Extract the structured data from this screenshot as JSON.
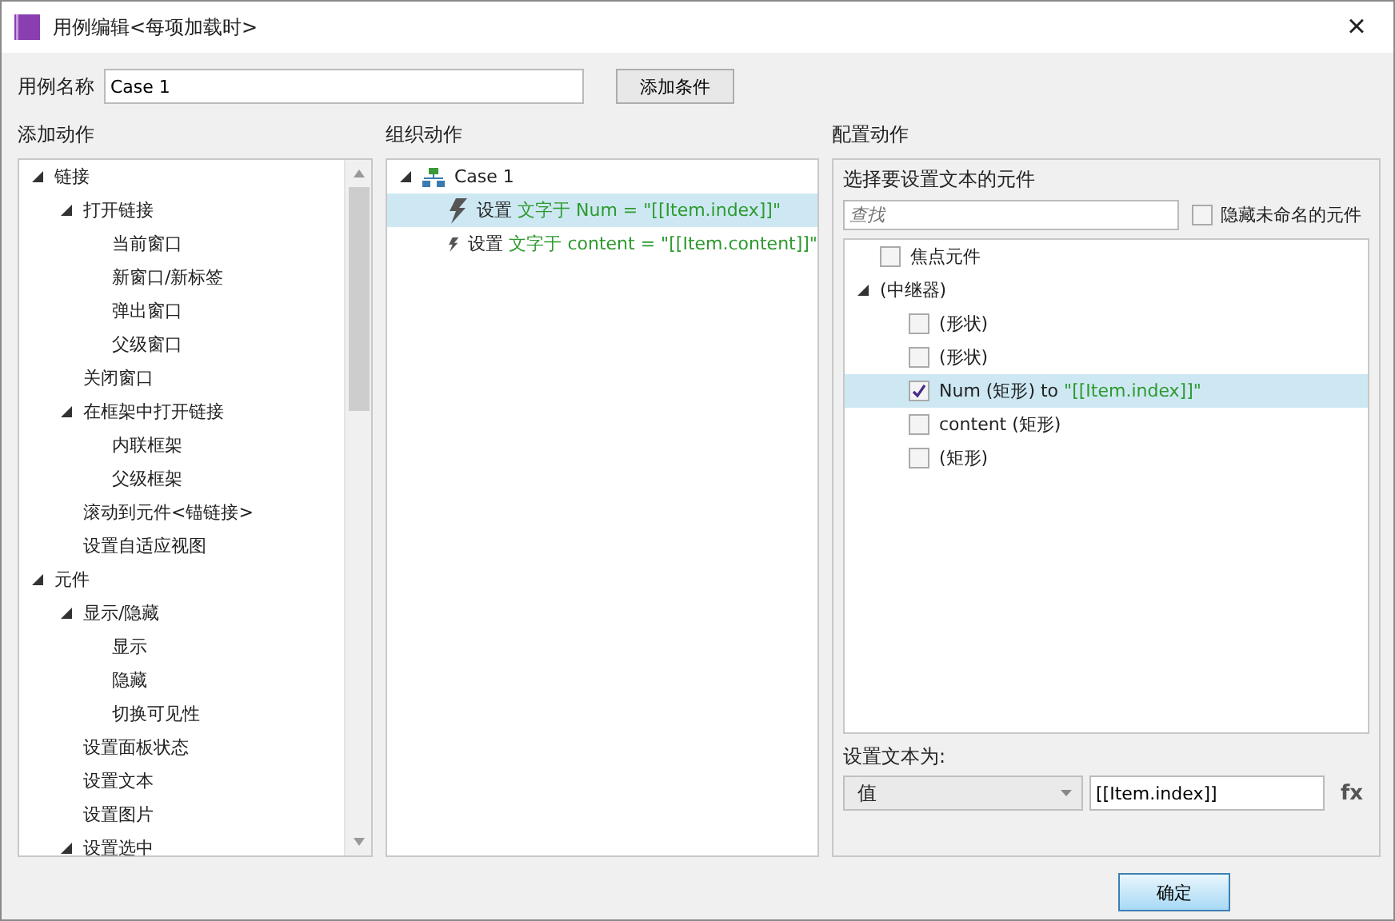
{
  "window": {
    "title": "用例编辑<每项加载时>",
    "close": "×"
  },
  "case_name": {
    "label": "用例名称",
    "value": "Case 1"
  },
  "add_condition_button": "添加条件",
  "add_actions": {
    "heading": "添加动作",
    "tree": [
      {
        "label": "链接",
        "expanded": true,
        "children": [
          {
            "label": "打开链接",
            "expanded": true,
            "children": [
              {
                "label": "当前窗口"
              },
              {
                "label": "新窗口/新标签"
              },
              {
                "label": "弹出窗口"
              },
              {
                "label": "父级窗口"
              }
            ]
          },
          {
            "label": "关闭窗口"
          },
          {
            "label": "在框架中打开链接",
            "expanded": true,
            "children": [
              {
                "label": "内联框架"
              },
              {
                "label": "父级框架"
              }
            ]
          },
          {
            "label": "滚动到元件<锚链接>"
          },
          {
            "label": "设置自适应视图"
          }
        ]
      },
      {
        "label": "元件",
        "expanded": true,
        "children": [
          {
            "label": "显示/隐藏",
            "expanded": true,
            "children": [
              {
                "label": "显示"
              },
              {
                "label": "隐藏"
              },
              {
                "label": "切换可见性"
              }
            ]
          },
          {
            "label": "设置面板状态"
          },
          {
            "label": "设置文本"
          },
          {
            "label": "设置图片"
          },
          {
            "label": "设置选中",
            "expanded": true
          }
        ]
      }
    ]
  },
  "organize_actions": {
    "heading": "组织动作",
    "case": {
      "label": "Case 1",
      "expanded": true
    },
    "actions": [
      {
        "verb": "设置",
        "detail": "文字于 Num = \"[[Item.index]]\"",
        "selected": true
      },
      {
        "verb": "设置",
        "detail": "文字于 content = \"[[Item.content]]\"",
        "selected": false
      }
    ]
  },
  "configure_actions": {
    "heading": "配置动作",
    "subheading": "选择要设置文本的元件",
    "search": {
      "placeholder": "查找"
    },
    "hide_unnamed": {
      "label": "隐藏未命名的元件",
      "checked": false
    },
    "widgets": [
      {
        "kind": "checkbox",
        "label": "焦点元件",
        "checked": false,
        "selected": false
      },
      {
        "kind": "group",
        "label": "(中继器)",
        "expanded": true,
        "selected": false,
        "children": [
          {
            "kind": "checkbox",
            "label": "(形状)",
            "checked": false,
            "selected": false
          },
          {
            "kind": "checkbox",
            "label": "(形状)",
            "checked": false,
            "selected": false
          },
          {
            "kind": "checkbox",
            "label": "Num (矩形) to ",
            "target": "\"[[Item.index]]\"",
            "checked": true,
            "selected": true
          },
          {
            "kind": "checkbox",
            "label": "content (矩形)",
            "checked": false,
            "selected": false
          },
          {
            "kind": "checkbox",
            "label": "(矩形)",
            "checked": false,
            "selected": false
          }
        ]
      }
    ],
    "set_text": {
      "label": "设置文本为:",
      "mode": "值",
      "value": "[[Item.index]]",
      "fx": "fx"
    }
  },
  "buttons": [
    {
      "label": "确定"
    }
  ]
}
